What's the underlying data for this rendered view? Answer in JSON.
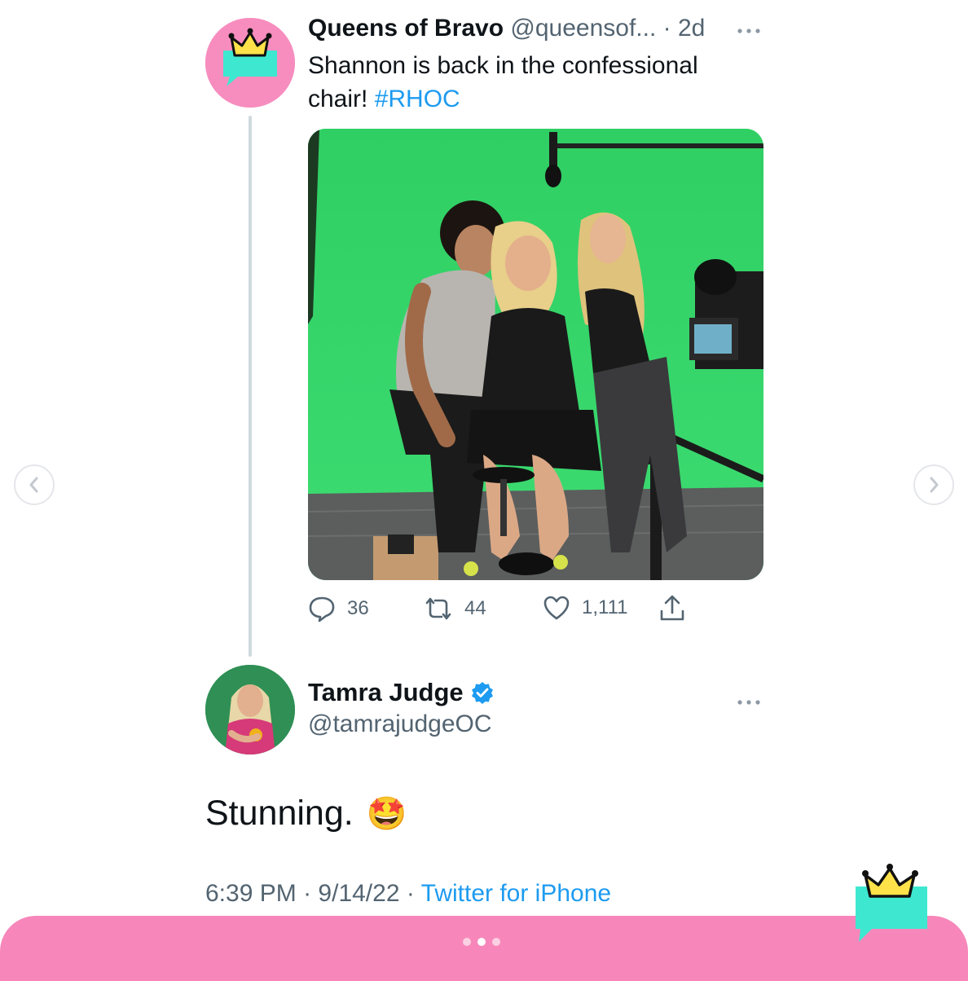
{
  "quoted_tweet": {
    "display_name": "Queens of Bravo",
    "handle": "@queensof...",
    "separator": "·",
    "time_ago": "2d",
    "text_main": "Shannon is back in the confessional chair!",
    "hashtag": "#RHOC",
    "stats": {
      "replies": "36",
      "retweets": "44",
      "likes": "1,111"
    }
  },
  "reply_tweet": {
    "display_name": "Tamra Judge",
    "handle": "@tamrajudgeOC",
    "text": "Stunning.",
    "emoji": "🤩",
    "time": "6:39 PM",
    "date": "9/14/22",
    "separator": "·",
    "source": "Twitter for iPhone"
  },
  "carousel": {
    "dot_count": 3,
    "active_index": 1
  },
  "colors": {
    "pink": "#f787ba",
    "teal": "#3ee8d0",
    "link_blue": "#1d9bf0",
    "verified_blue": "#1d9bf0"
  },
  "icons": [
    "chevron-left-icon",
    "chevron-right-icon",
    "more-icon",
    "reply-icon",
    "retweet-icon",
    "like-icon",
    "share-icon",
    "verified-icon",
    "crown-logo"
  ]
}
